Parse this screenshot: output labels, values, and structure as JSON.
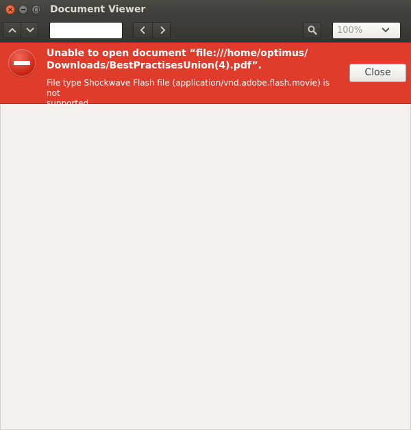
{
  "window": {
    "title": "Document Viewer",
    "close_glyph": "×"
  },
  "toolbar": {
    "prev_page_icon": "chevron-up-icon",
    "next_page_icon": "chevron-down-icon",
    "page_entry_value": "",
    "back_icon": "chevron-left-icon",
    "forward_icon": "chevron-right-icon",
    "search_icon": "search-icon",
    "zoom_value": "100%",
    "zoom_dropdown_icon": "chevron-down-icon"
  },
  "error_bar": {
    "title": "Unable to open document “file:///home/optimus/Downloads/BestPractisesUnion(4).pdf”.",
    "title_line1": "Unable to open document “file:///home/optimus/",
    "title_line2": "Downloads/BestPractisesUnion(4).pdf”.",
    "detail": "File type Shockwave Flash file (application/vnd.adobe.flash.movie) is not supported",
    "detail_line1": "File type Shockwave Flash file (application/vnd.adobe.flash.movie) is not",
    "detail_line2": "supported",
    "close_label": "Close",
    "icon": "error-icon",
    "color": "#e03c2c"
  },
  "colors": {
    "titlebar": "#3c3b37",
    "content_bg": "#f2f1f0",
    "close_button": "#df4b16"
  }
}
